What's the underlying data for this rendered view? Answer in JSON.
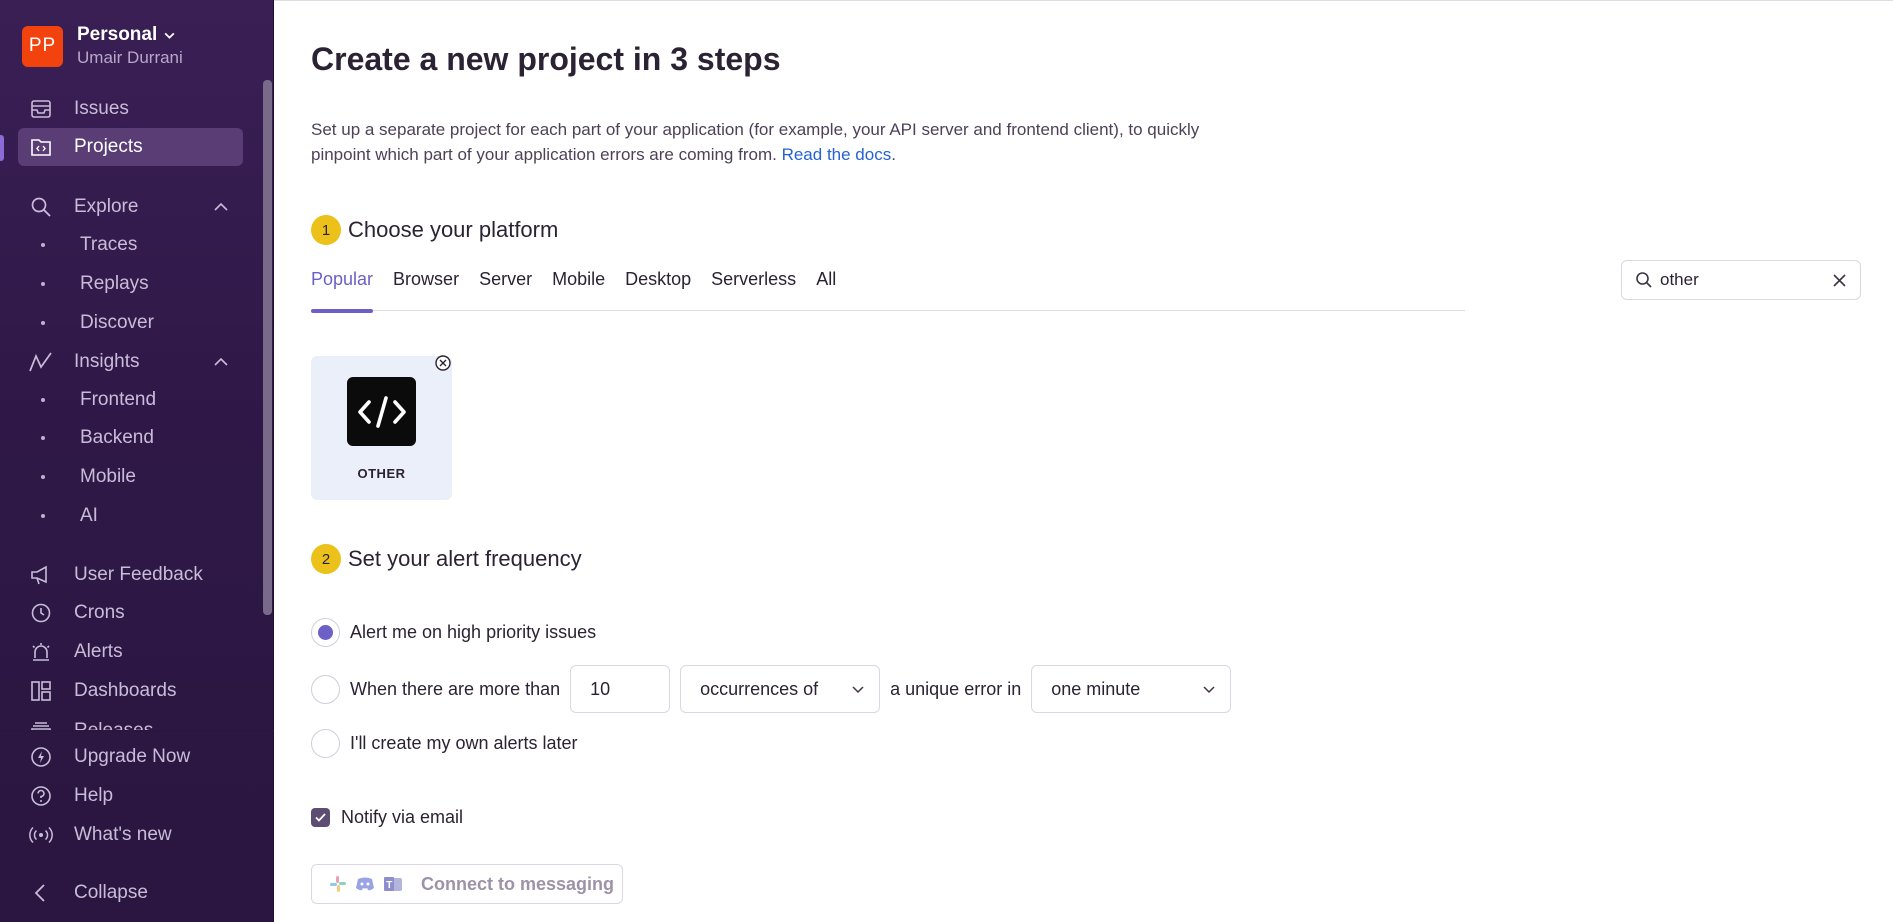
{
  "org": {
    "initials": "PP",
    "name": "Personal",
    "user": "Umair Durrani",
    "avatar_color": "#f2430f"
  },
  "sidebar": {
    "issues": "Issues",
    "projects": "Projects",
    "explore": "Explore",
    "explore_items": [
      "Traces",
      "Replays",
      "Discover"
    ],
    "insights": "Insights",
    "insights_items": [
      "Frontend",
      "Backend",
      "Mobile",
      "AI"
    ],
    "user_feedback": "User Feedback",
    "crons": "Crons",
    "alerts": "Alerts",
    "dashboards": "Dashboards",
    "releases": "Releases",
    "upgrade": "Upgrade Now",
    "help": "Help",
    "whats_new": "What's new",
    "collapse": "Collapse"
  },
  "page": {
    "title": "Create a new project in 3 steps",
    "description": "Set up a separate project for each part of your application (for example, your API server and frontend client), to quickly pinpoint which part of your application errors are coming from.",
    "docs_link": "Read the docs",
    "docs_suffix": "."
  },
  "step1": {
    "number": "1",
    "title": "Choose your platform",
    "tabs": [
      "Popular",
      "Browser",
      "Server",
      "Mobile",
      "Desktop",
      "Serverless",
      "All"
    ],
    "active_tab": "Popular",
    "search_value": "other",
    "platform_label": "OTHER"
  },
  "step2": {
    "number": "2",
    "title": "Set your alert frequency",
    "option_high_priority": "Alert me on high priority issues",
    "option_threshold_prefix": "When there are more than",
    "threshold_value": "10",
    "threshold_metric": "occurrences of",
    "threshold_middle": "a unique error in",
    "threshold_interval": "one minute",
    "option_later": "I'll create my own alerts later",
    "selected_option": "high_priority",
    "notify_email": "Notify via email",
    "notify_email_checked": true,
    "connect_messaging": "Connect to messaging"
  },
  "colors": {
    "accent": "#6c5fc7",
    "step_badge": "#ecc11a",
    "link": "#2562d4",
    "sidebar_bg": "#2f1847"
  }
}
